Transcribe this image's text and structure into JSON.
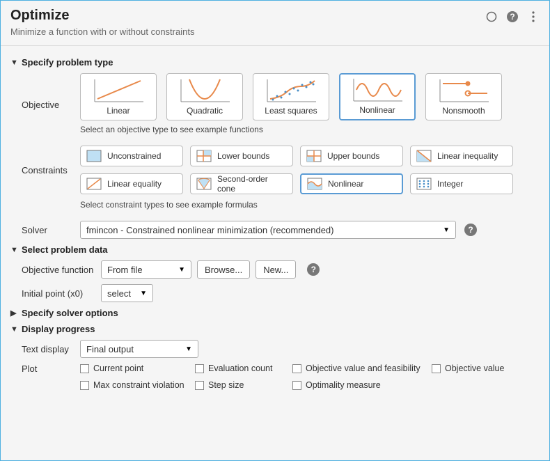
{
  "header": {
    "title": "Optimize",
    "subtitle": "Minimize a function with or without constraints"
  },
  "sections": {
    "specify_problem_type": "Specify problem type",
    "select_problem_data": "Select problem data",
    "specify_solver_options": "Specify solver options",
    "display_progress": "Display progress"
  },
  "labels": {
    "objective": "Objective",
    "constraints": "Constraints",
    "solver": "Solver",
    "objective_function": "Objective function",
    "initial_point": "Initial point (x0)",
    "text_display": "Text display",
    "plot": "Plot"
  },
  "objective": {
    "hint": "Select an objective type to see example functions",
    "options": {
      "linear": "Linear",
      "quadratic": "Quadratic",
      "least_squares": "Least squares",
      "nonlinear": "Nonlinear",
      "nonsmooth": "Nonsmooth"
    }
  },
  "constraints": {
    "hint": "Select constraint types to see example formulas",
    "options": {
      "unconstrained": "Unconstrained",
      "lower_bounds": "Lower bounds",
      "upper_bounds": "Upper bounds",
      "linear_inequality": "Linear inequality",
      "linear_equality": "Linear equality",
      "second_order_cone": "Second-order cone",
      "nonlinear": "Nonlinear",
      "integer": "Integer"
    }
  },
  "solver": {
    "value": "fmincon - Constrained nonlinear minimization (recommended)"
  },
  "problem_data": {
    "obj_fun_source": "From file",
    "browse_label": "Browse...",
    "new_label": "New...",
    "initial_point_value": "select"
  },
  "display": {
    "text_display_value": "Final output",
    "plot_options": {
      "current_point": "Current point",
      "evaluation_count": "Evaluation count",
      "objective_value_feasibility": "Objective value and feasibility",
      "objective_value": "Objective value",
      "max_constraint_violation": "Max constraint violation",
      "step_size": "Step size",
      "optimality_measure": "Optimality measure"
    }
  }
}
